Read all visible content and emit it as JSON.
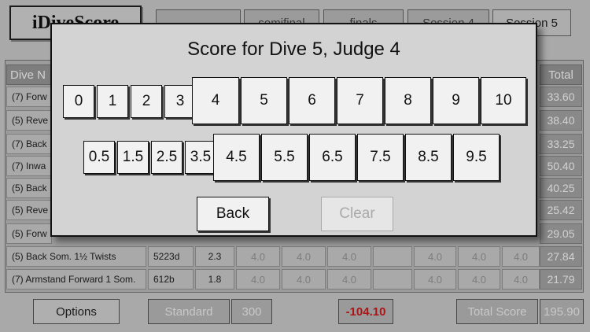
{
  "app": {
    "logo": "iDiveScore"
  },
  "top_tabs": [
    "",
    "semifinal",
    "finals",
    "Session 4",
    "Session 5"
  ],
  "table": {
    "header_first": "Dive N",
    "header_total": "Total",
    "rows": [
      {
        "dive": "(7) Forw",
        "total": "33.60"
      },
      {
        "dive": "(5) Reve",
        "total": "38.40"
      },
      {
        "dive": "(7) Back",
        "total": "33.25"
      },
      {
        "dive": "(7) Inwa",
        "total": "50.40"
      },
      {
        "dive": "(5) Back",
        "total": "40.25"
      },
      {
        "dive": "(5) Reve",
        "total": "25.42"
      },
      {
        "dive": "(5) Forw",
        "total": "29.05"
      },
      {
        "dive": "(5) Back Som. 1½ Twists",
        "code": "5223d",
        "dd": "2.3",
        "scores": [
          "4.0",
          "4.0",
          "4.0",
          "",
          "4.0",
          "4.0",
          "4.0"
        ],
        "total": "27.84"
      },
      {
        "dive": "(7) Armstand Forward 1 Som.",
        "code": "612b",
        "dd": "1.8",
        "scores": [
          "4.0",
          "4.0",
          "4.0",
          "",
          "4.0",
          "4.0",
          "4.0"
        ],
        "total": "21.79"
      }
    ]
  },
  "bottom": {
    "options": "Options",
    "standard": "Standard",
    "standard_value": "300",
    "difference": "-104.10",
    "total_label": "Total Score",
    "total_value": "195.90"
  },
  "modal": {
    "title": "Score for Dive 5, Judge 4",
    "row1": [
      "0",
      "1",
      "2",
      "3",
      "4",
      "5",
      "6",
      "7",
      "8",
      "9",
      "10"
    ],
    "row2": [
      "0.5",
      "1.5",
      "2.5",
      "3.5",
      "4.5",
      "5.5",
      "6.5",
      "7.5",
      "8.5",
      "9.5"
    ],
    "back": "Back",
    "clear": "Clear"
  },
  "colors": {
    "difference": "#d11a1a"
  }
}
